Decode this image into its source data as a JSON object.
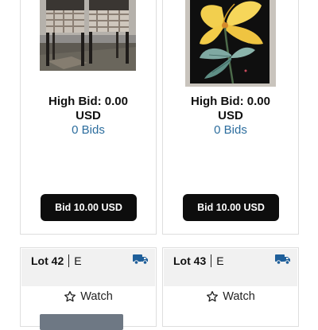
{
  "lots_top": [
    {
      "image_name": "folding-chairs-photo",
      "high_bid": "High Bid: 0.00",
      "currency": "USD",
      "bids": "0 Bids",
      "bid_button": "Bid 10.00 USD"
    },
    {
      "image_name": "flower-painting-photo",
      "high_bid": "High Bid: 0.00",
      "currency": "USD",
      "bids": "0 Bids",
      "bid_button": "Bid 10.00 USD"
    }
  ],
  "lots_bottom": [
    {
      "lot_label": "Lot 42",
      "lot_code": "E",
      "shipping_icon": "truck-icon",
      "watch_label": "Watch"
    },
    {
      "lot_label": "Lot 43",
      "lot_code": "E",
      "shipping_icon": "truck-icon",
      "watch_label": "Watch"
    }
  ],
  "colors": {
    "accent_link": "#2c6d9e",
    "button_bg": "#0d0d0d",
    "truck_icon": "#1f5f9a",
    "card_border": "#dedede",
    "header_bg": "#f1f1f1"
  }
}
